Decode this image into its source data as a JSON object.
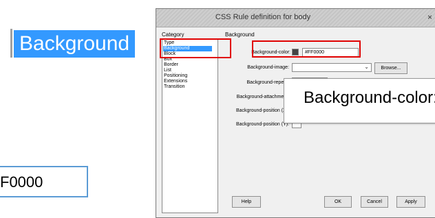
{
  "zoom": {
    "background_label": "Background",
    "color_field_value": "F0000"
  },
  "dialog": {
    "title": "CSS Rule definition for body",
    "close_glyph": "×",
    "category_label": "Category",
    "categories": [
      {
        "label": "Type",
        "selected": false
      },
      {
        "label": "Background",
        "selected": true
      },
      {
        "label": "Block",
        "selected": false
      },
      {
        "label": "Box",
        "selected": false
      },
      {
        "label": "Border",
        "selected": false
      },
      {
        "label": "List",
        "selected": false
      },
      {
        "label": "Positioning",
        "selected": false
      },
      {
        "label": "Extensions",
        "selected": false
      },
      {
        "label": "Transition",
        "selected": false
      }
    ],
    "section_label": "Background",
    "fields": {
      "background_color_label": "Background-color:",
      "background_color_value": "#FF0000",
      "background_image_label": "Background-image:",
      "browse_label": "Browse...",
      "background_repeat_label": "Background-repeat:",
      "background_attachment_label": "Background-attachment:",
      "background_position_x_label": "Background-position (X):",
      "background_position_y_label": "Background-position (Y):"
    },
    "magnifier_text": "Background-color:",
    "buttons": {
      "help": "Help",
      "ok": "OK",
      "cancel": "Cancel",
      "apply": "Apply"
    }
  },
  "colors": {
    "highlight": "#3399ff",
    "annotation": "#e00000",
    "swatch": "#444444"
  }
}
